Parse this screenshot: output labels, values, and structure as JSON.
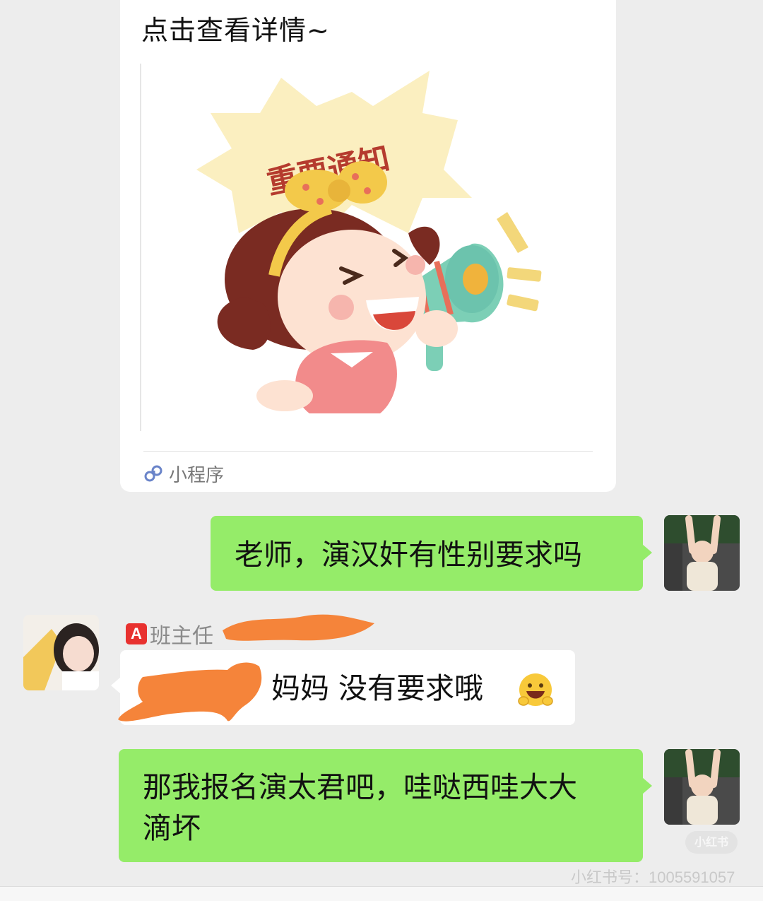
{
  "mini_program_card": {
    "title": "点击查看详情~",
    "banner_text": "重要通知",
    "footer_label": "小程序"
  },
  "messages": [
    {
      "from": "me",
      "text": "老师，演汉奸有性别要求吗"
    },
    {
      "from": "them",
      "sender_badge": "A",
      "sender_name": "班主任",
      "text_visible": "妈妈  没有要求哦"
    },
    {
      "from": "me",
      "text_line1": "那我报名演太君吧，哇哒西哇大大",
      "text_line2": "滴坏"
    }
  ],
  "watermark": {
    "pill": "小红书",
    "id_text": "小红书号：1005591057"
  },
  "colors": {
    "background": "#ededed",
    "my_bubble": "#95ec69",
    "their_bubble": "#ffffff",
    "redaction": "#f5843a"
  }
}
